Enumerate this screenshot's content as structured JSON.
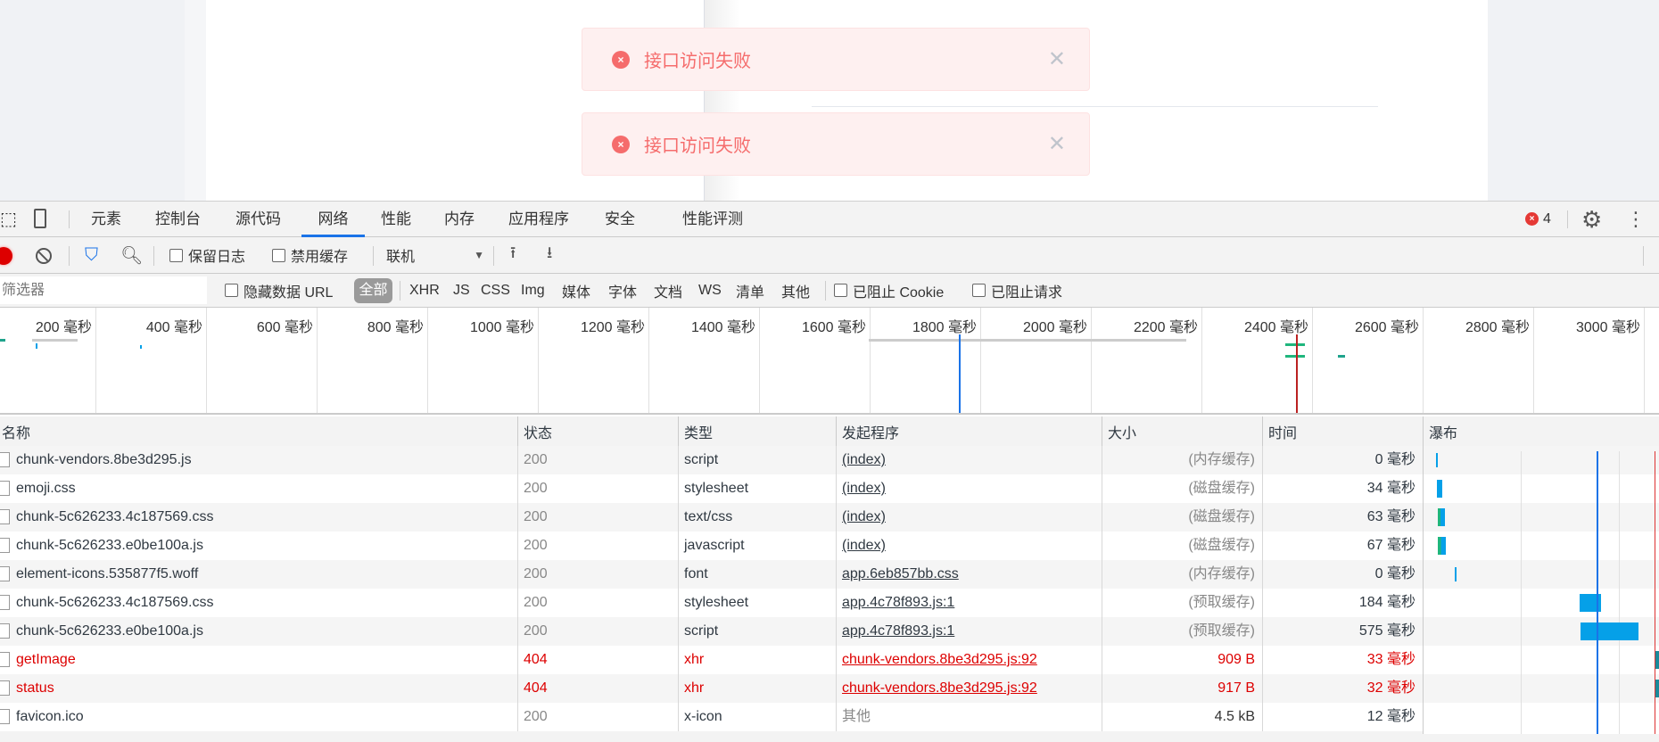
{
  "page": {
    "messages": [
      {
        "text": "接口访问失败"
      },
      {
        "text": "接口访问失败"
      }
    ]
  },
  "tabs": [
    {
      "label": "元素"
    },
    {
      "label": "控制台"
    },
    {
      "label": "源代码"
    },
    {
      "label": "网络",
      "active": true
    },
    {
      "label": "性能"
    },
    {
      "label": "内存"
    },
    {
      "label": "应用程序"
    },
    {
      "label": "安全"
    },
    {
      "label": "性能评测"
    }
  ],
  "errors": {
    "count": "4"
  },
  "toolbar": {
    "preserve_log": "保留日志",
    "disable_cache": "禁用缓存",
    "throttling": "联机"
  },
  "filters": {
    "placeholder": "筛选器",
    "hide_data_urls": "隐藏数据 URL",
    "types": [
      "全部",
      "XHR",
      "JS",
      "CSS",
      "Img",
      "媒体",
      "字体",
      "文档",
      "WS",
      "清单",
      "其他"
    ],
    "blocked_cookies": "已阻止 Cookie",
    "blocked_requests": "已阻止请求"
  },
  "overview": {
    "ticks": [
      "200 毫秒",
      "400 毫秒",
      "600 毫秒",
      "800 毫秒",
      "1000 毫秒",
      "1200 毫秒",
      "1400 毫秒",
      "1600 毫秒",
      "1800 毫秒",
      "2000 毫秒",
      "2200 毫秒",
      "2400 毫秒",
      "2600 毫秒",
      "2800 毫秒",
      "3000 毫秒"
    ]
  },
  "table": {
    "headers": {
      "name": "名称",
      "status": "状态",
      "type": "类型",
      "initiator": "发起程序",
      "size": "大小",
      "time": "时间",
      "waterfall": "瀑布"
    },
    "rows": [
      {
        "name": "chunk-vendors.8be3d295.js",
        "status": "200",
        "type": "script",
        "initiator": "(index)",
        "size": "(内存缓存)",
        "time": "0 毫秒"
      },
      {
        "name": "emoji.css",
        "status": "200",
        "type": "stylesheet",
        "initiator": "(index)",
        "size": "(磁盘缓存)",
        "time": "34 毫秒"
      },
      {
        "name": "chunk-5c626233.4c187569.css",
        "status": "200",
        "type": "text/css",
        "initiator": "(index)",
        "size": "(磁盘缓存)",
        "time": "63 毫秒"
      },
      {
        "name": "chunk-5c626233.e0be100a.js",
        "status": "200",
        "type": "javascript",
        "initiator": "(index)",
        "size": "(磁盘缓存)",
        "time": "67 毫秒"
      },
      {
        "name": "element-icons.535877f5.woff",
        "status": "200",
        "type": "font",
        "initiator": "app.6eb857bb.css",
        "size": "(内存缓存)",
        "time": "0 毫秒"
      },
      {
        "name": "chunk-5c626233.4c187569.css",
        "status": "200",
        "type": "stylesheet",
        "initiator": "app.4c78f893.js:1",
        "size": "(预取缓存)",
        "time": "184 毫秒"
      },
      {
        "name": "chunk-5c626233.e0be100a.js",
        "status": "200",
        "type": "script",
        "initiator": "app.4c78f893.js:1",
        "size": "(预取缓存)",
        "time": "575 毫秒"
      },
      {
        "name": "getImage",
        "status": "404",
        "type": "xhr",
        "initiator": "chunk-vendors.8be3d295.js:92",
        "size": "909 B",
        "time": "33 毫秒",
        "error": true
      },
      {
        "name": "status",
        "status": "404",
        "type": "xhr",
        "initiator": "chunk-vendors.8be3d295.js:92",
        "size": "917 B",
        "time": "32 毫秒",
        "error": true
      },
      {
        "name": "favicon.ico",
        "status": "200",
        "type": "x-icon",
        "initiator": "其他",
        "size": "4.5 kB",
        "time": "12 毫秒"
      }
    ]
  }
}
